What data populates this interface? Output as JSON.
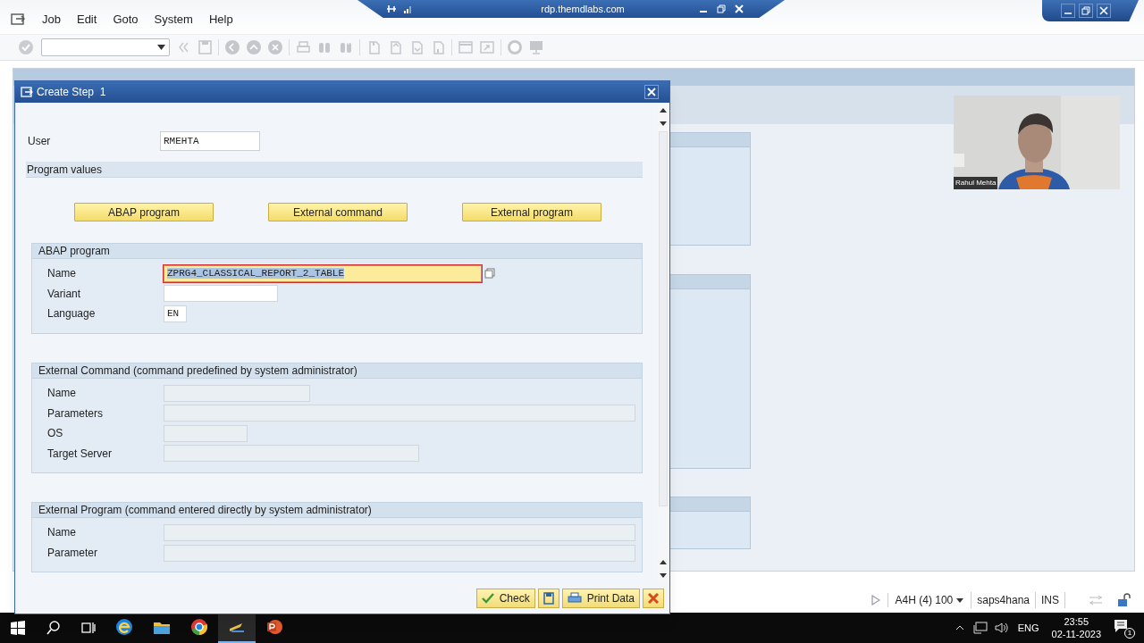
{
  "remote_bar": {
    "host": "rdp.themdlabs.com"
  },
  "menu": [
    {
      "label": "Job"
    },
    {
      "label": "Edit"
    },
    {
      "label": "Goto"
    },
    {
      "label": "System"
    },
    {
      "label": "Help"
    }
  ],
  "dialog": {
    "title": "Create Step  1",
    "user": {
      "label": "User",
      "value": "RMEHTA"
    },
    "program_values": {
      "title": "Program values",
      "buttons": [
        {
          "label": "ABAP program"
        },
        {
          "label": "External command"
        },
        {
          "label": "External program"
        }
      ]
    },
    "groups": [
      {
        "title": "ABAP program",
        "fields": [
          {
            "label": "Name",
            "value": "ZPRG4_CLASSICAL_REPORT_2_TABLE",
            "focused": true,
            "disabled": false
          },
          {
            "label": "Variant",
            "focused": false,
            "disabled": false
          },
          {
            "label": "Language",
            "value": "EN",
            "focused": false,
            "disabled": false
          }
        ]
      },
      {
        "title": "External Command (command predefined by system administrator)",
        "fields": [
          {
            "label": "Name",
            "focused": false,
            "disabled": true
          },
          {
            "label": "Parameters",
            "focused": false,
            "disabled": true
          },
          {
            "label": "OS",
            "focused": false,
            "disabled": true
          },
          {
            "label": "Target Server",
            "focused": false,
            "disabled": true
          }
        ]
      },
      {
        "title": "External Program (command entered directly by system administrator)",
        "fields": [
          {
            "label": "Name",
            "focused": false,
            "disabled": true
          },
          {
            "label": "Parameter",
            "focused": false,
            "disabled": true
          }
        ]
      }
    ],
    "footer_buttons": [
      {
        "kind": "check",
        "label": "Check"
      },
      {
        "kind": "save"
      },
      {
        "kind": "print",
        "label": "Print Data"
      },
      {
        "kind": "cancel"
      }
    ]
  },
  "webcam": {
    "kind": "picture",
    "name": "Rahul Mehta"
  },
  "status_bar": {
    "system": "A4H (4) 100",
    "server": "saps4hana",
    "mode": "INS"
  },
  "taskbar": {
    "apps": [
      {
        "kind": "edge",
        "active": false
      },
      {
        "kind": "folder",
        "active": false
      },
      {
        "kind": "chrome",
        "active": false
      },
      {
        "kind": "sap",
        "active": true
      },
      {
        "kind": "powerpoint",
        "active": false
      }
    ],
    "language": "ENG",
    "time": "23:55",
    "date": "02-11-2023",
    "notifications": "1"
  }
}
